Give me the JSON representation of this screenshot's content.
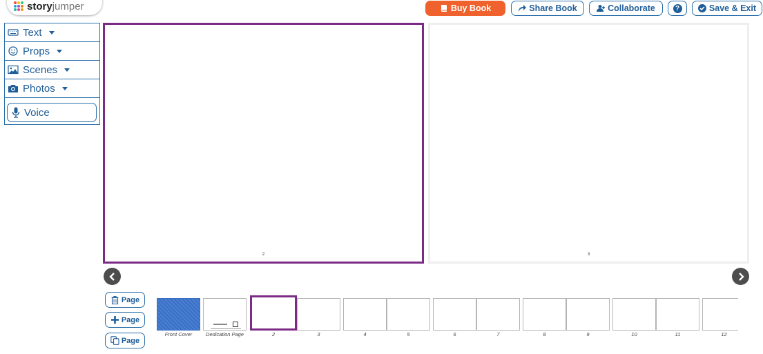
{
  "logo": {
    "bold": "story",
    "light": "jumper"
  },
  "toolbar": {
    "buy_label": "Buy Book",
    "share_label": "Share Book",
    "collaborate_label": "Collaborate",
    "help_label": "?",
    "save_label": "Save & Exit"
  },
  "sidebar": {
    "items": [
      {
        "label": "Text",
        "icon": "keyboard-icon"
      },
      {
        "label": "Props",
        "icon": "smiley-icon"
      },
      {
        "label": "Scenes",
        "icon": "image-icon"
      },
      {
        "label": "Photos",
        "icon": "camera-icon"
      }
    ],
    "voice_label": "Voice"
  },
  "spread": {
    "left_page_number": "2",
    "right_page_number": "3"
  },
  "page_buttons": {
    "delete_label": "Page",
    "add_label": "Page",
    "duplicate_label": "Page"
  },
  "thumbnails": {
    "labels": [
      "Front Cover",
      "Dedication Page",
      "2",
      "3",
      "4",
      "5",
      "6",
      "7",
      "8",
      "9",
      "10",
      "11",
      "12"
    ],
    "selected": "2"
  },
  "colors": {
    "accent": "#2b6fab",
    "buy": "#f0622d",
    "selected_border": "#7b2a86",
    "cover": "#3a6fc4"
  }
}
